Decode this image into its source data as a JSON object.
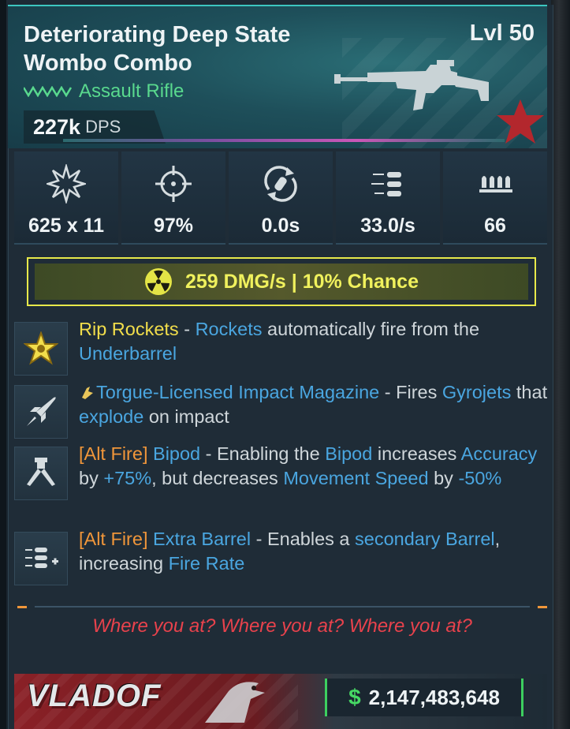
{
  "item": {
    "name": "Deteriorating Deep State Wombo Combo",
    "level": "Lvl 50",
    "type": "Assault Rifle",
    "dps_value": "227k",
    "dps_unit": "DPS"
  },
  "stats": [
    {
      "icon": "damage-burst-icon",
      "value": "625 x 11"
    },
    {
      "icon": "crosshair-icon",
      "value": "97%"
    },
    {
      "icon": "reload-icon",
      "value": "0.0s"
    },
    {
      "icon": "fire-rate-bullets-icon",
      "value": "33.0/s"
    },
    {
      "icon": "magazine-icon",
      "value": "66"
    }
  ],
  "element": {
    "icon": "radiation-icon",
    "text": "259 DMG/s | 10% Chance",
    "color": "#f0f15d"
  },
  "perks": [
    {
      "icon": "rip-rockets-star-icon",
      "parts": [
        "Rip Rockets",
        " - ",
        "Rockets",
        " automatically fire from the ",
        "Underbarrel"
      ]
    },
    {
      "icon": "rocket-icon",
      "parts": [
        "Torgue-Licensed Impact Magazine",
        " - Fires ",
        "Gyrojets",
        " that ",
        "explode",
        " on impact"
      ]
    },
    {
      "icon": "bipod-icon",
      "parts": [
        "[Alt Fire]",
        " Bipod",
        " - Enabling the ",
        "Bipod",
        " increases ",
        "Accuracy",
        " by ",
        "+75%",
        ", but decreases ",
        "Movement Speed",
        " by ",
        "-50%"
      ]
    },
    {
      "icon": "extra-barrel-icon",
      "parts": [
        "[Alt Fire]",
        " Extra Barrel",
        " - Enables a ",
        "secondary Barrel",
        ", increasing ",
        "Fire Rate"
      ]
    }
  ],
  "flavor_text": "Where you at? Where you at? Where you at?",
  "footer": {
    "manufacturer": "VLADOF",
    "currency_symbol": "$",
    "price": "2,147,483,648"
  },
  "colors": {
    "header_teal": "#1e4f5a",
    "rarity_green": "#59d98e",
    "highlight_blue": "#4aa6e0",
    "highlight_yellow": "#f2de4b",
    "alt_fire_orange": "#f0963a",
    "flavor_red": "#e8424c",
    "price_green": "#46d864"
  }
}
